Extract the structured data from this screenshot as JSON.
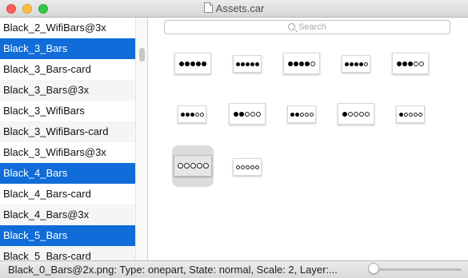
{
  "window": {
    "title": "Assets.car"
  },
  "sidebar": {
    "items": [
      {
        "label": "Black_2_WifiBars@3x",
        "selected": false
      },
      {
        "label": "Black_3_Bars",
        "selected": true
      },
      {
        "label": "Black_3_Bars-card",
        "selected": false
      },
      {
        "label": "Black_3_Bars@3x",
        "selected": false
      },
      {
        "label": "Black_3_WifiBars",
        "selected": false
      },
      {
        "label": "Black_3_WifiBars-card",
        "selected": false
      },
      {
        "label": "Black_3_WifiBars@3x",
        "selected": false
      },
      {
        "label": "Black_4_Bars",
        "selected": true
      },
      {
        "label": "Black_4_Bars-card",
        "selected": false
      },
      {
        "label": "Black_4_Bars@3x",
        "selected": false
      },
      {
        "label": "Black_5_Bars",
        "selected": true
      },
      {
        "label": "Black_5_Bars-card",
        "selected": false
      }
    ]
  },
  "search": {
    "placeholder": "Search"
  },
  "assets": [
    {
      "filled": 5,
      "total": 5,
      "selected": false
    },
    {
      "filled": 5,
      "total": 5,
      "selected": false
    },
    {
      "filled": 4,
      "total": 5,
      "selected": false
    },
    {
      "filled": 4,
      "total": 5,
      "selected": false
    },
    {
      "filled": 3,
      "total": 5,
      "selected": false
    },
    {
      "filled": 3,
      "total": 5,
      "selected": false
    },
    {
      "filled": 2,
      "total": 5,
      "selected": false
    },
    {
      "filled": 2,
      "total": 5,
      "selected": false
    },
    {
      "filled": 1,
      "total": 5,
      "selected": false
    },
    {
      "filled": 1,
      "total": 5,
      "selected": false
    },
    {
      "filled": 0,
      "total": 5,
      "selected": true
    },
    {
      "filled": 0,
      "total": 5,
      "selected": false
    }
  ],
  "status": {
    "text": "Black_0_Bars@2x.png: Type: onepart, State: normal, Scale: 2, Layer:..."
  },
  "zoom_slider": {
    "value": 0
  },
  "colors": {
    "selection": "#0f6cd8",
    "close": "#fc605c",
    "minimize": "#fdbc40",
    "maximize": "#34c84a"
  }
}
